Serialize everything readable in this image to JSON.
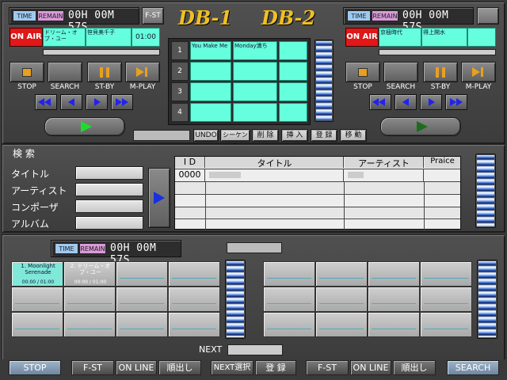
{
  "logos": {
    "db1": "DB-1",
    "db2": "DB-2"
  },
  "left_deck": {
    "time_pill": "TIME",
    "remain_pill": "REMAIN",
    "time": "00H 00M 57S",
    "fst": "F-ST",
    "onair": "ON AIR",
    "track_title": "ドリーム・オブ・ユー",
    "track_artist": "笹貝美千子",
    "track_time": "01:00",
    "buttons": [
      "STOP",
      "SEARCH",
      "ST-BY",
      "M-PLAY"
    ]
  },
  "right_deck": {
    "time_pill": "TIME",
    "remain_pill": "REMAIN",
    "time": "00H 00M 57S",
    "onair": "ON AIR",
    "track_title": "京極時代",
    "track_artist": "得上開水",
    "buttons": [
      "STOP",
      "SEARCH",
      "ST-BY",
      "M-PLAY"
    ]
  },
  "cue_list": {
    "rows": [
      {
        "num": "1",
        "title": "You Make Me",
        "artist": "Monday満ち",
        "c3": ""
      },
      {
        "num": "2",
        "title": "",
        "artist": "",
        "c3": ""
      },
      {
        "num": "3",
        "title": "",
        "artist": "",
        "c3": ""
      },
      {
        "num": "4",
        "title": "",
        "artist": "",
        "c3": ""
      }
    ]
  },
  "edit_toolbar": {
    "undo": "UNDO",
    "sequence": "シーケンス",
    "delete": "削 除",
    "insert": "挿 入",
    "register": "登 録",
    "move": "移 動"
  },
  "search": {
    "heading": "検 索",
    "fields": [
      {
        "label": "タイトル",
        "value": ""
      },
      {
        "label": "アーティスト",
        "value": ""
      },
      {
        "label": "コンポーザ",
        "value": ""
      },
      {
        "label": "アルバム",
        "value": ""
      }
    ],
    "table": {
      "headers": [
        "I D",
        "タイトル",
        "アーティスト",
        "Praice"
      ],
      "rows": [
        [
          "0000",
          "",
          "",
          ""
        ],
        [
          "",
          "",
          "",
          ""
        ],
        [
          "",
          "",
          "",
          ""
        ],
        [
          "",
          "",
          "",
          ""
        ],
        [
          "",
          "",
          "",
          ""
        ]
      ]
    }
  },
  "cart": {
    "time_pill": "TIME",
    "remain_pill": "REMAIN",
    "time": "00H 00M 57S",
    "left_first": {
      "title": "1. Moonlight Serenade",
      "time": "00:00 / 01:00"
    },
    "left_second": {
      "title": "2. ドリーム・オブ・ユー",
      "time": "00:00 / 01:00"
    },
    "next_label": "NEXT"
  },
  "bottom_bar": {
    "stop": "STOP",
    "fst1": "F-ST",
    "online1": "ON LINE",
    "order1": "順出し",
    "next_select": "NEXT選択",
    "register": "登 録",
    "fst2": "F-ST",
    "online2": "ON LINE",
    "order2": "順出し",
    "search": "SEARCH"
  },
  "colors": {
    "onair": "#e01818",
    "cyan": "#66ffdd",
    "bg": "#3a3a3a"
  }
}
